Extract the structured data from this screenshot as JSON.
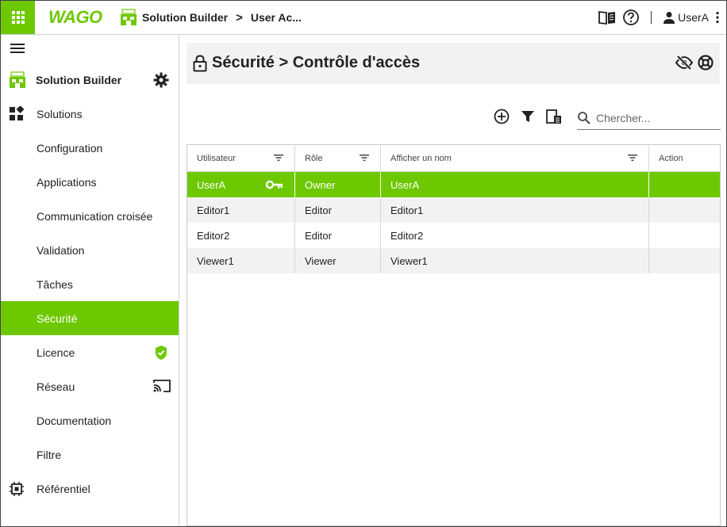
{
  "topbar": {
    "logo_text": "WAGO",
    "breadcrumbs": [
      "Solution Builder",
      "User Ac..."
    ],
    "user_label": "UserA"
  },
  "sidebar": {
    "header_title": "Solution Builder",
    "items": [
      {
        "label": "Solutions"
      },
      {
        "label": "Configuration"
      },
      {
        "label": "Applications"
      },
      {
        "label": "Communication croisée"
      },
      {
        "label": "Validation"
      },
      {
        "label": "Tâches"
      },
      {
        "label": "Sécurité"
      },
      {
        "label": "Licence"
      },
      {
        "label": "Réseau"
      },
      {
        "label": "Documentation"
      },
      {
        "label": "Filtre"
      },
      {
        "label": "Référentiel"
      }
    ],
    "active_item": "Sécurité"
  },
  "page": {
    "title": "Sécurité > Contrôle d'accès"
  },
  "search": {
    "placeholder": "Chercher..."
  },
  "table": {
    "columns": [
      "Utilisateur",
      "Rôle",
      "Afficher un nom",
      "Action"
    ],
    "rows": [
      {
        "user": "UserA",
        "role": "Owner",
        "display": "UserA",
        "selected": true
      },
      {
        "user": "Editor1",
        "role": "Editor",
        "display": "Editor1"
      },
      {
        "user": "Editor2",
        "role": "Editor",
        "display": "Editor2"
      },
      {
        "user": "Viewer1",
        "role": "Viewer",
        "display": "Viewer1"
      }
    ]
  },
  "colors": {
    "accent": "#6ec800",
    "row_alt": "#f2f2f2"
  }
}
